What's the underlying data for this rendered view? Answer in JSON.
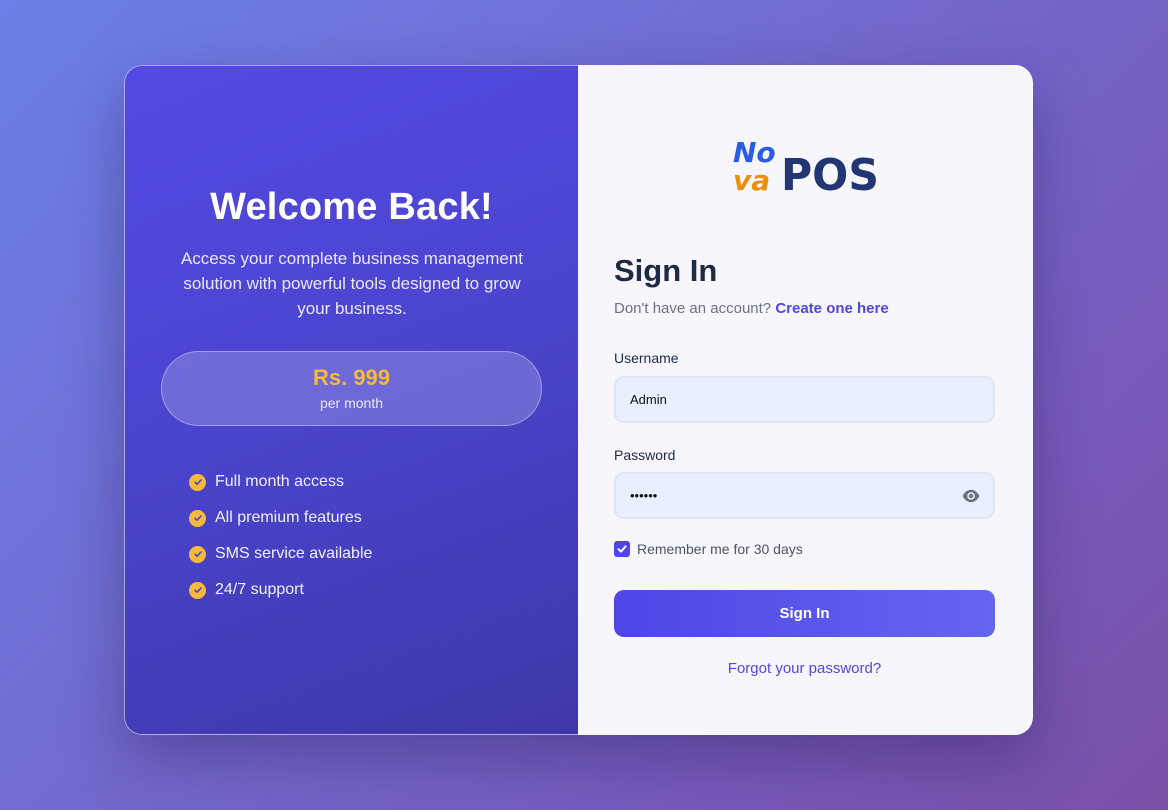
{
  "promo": {
    "title": "Welcome Back!",
    "subtitle": "Access your complete business management solution with powerful tools designed to grow your business.",
    "price": "Rs. 999",
    "period": "per month",
    "features": [
      {
        "label": "Full month access"
      },
      {
        "label": "All premium features"
      },
      {
        "label": "SMS service available"
      },
      {
        "label": "24/7 support"
      }
    ]
  },
  "logo": {
    "word_top": "No",
    "word_bottom": "va",
    "word_main": "POS"
  },
  "form": {
    "title": "Sign In",
    "account_prompt": "Don't have an account?",
    "create_link": "Create one here",
    "username_label": "Username",
    "username_value": "Admin",
    "password_label": "Password",
    "password_value": "••••••",
    "remember_label": "Remember me for 30 days",
    "remember_checked": true,
    "submit_label": "Sign In",
    "forgot_label": "Forgot your password?"
  },
  "colors": {
    "accent": "#4f46e5",
    "price": "#f6b93b",
    "logo_blue": "#2b5ce6",
    "logo_orange": "#e8900a",
    "logo_navy": "#233674"
  },
  "icons": {
    "check": "check-circle-icon",
    "eye": "eye-icon",
    "checkbox": "checkbox-checked-icon"
  }
}
